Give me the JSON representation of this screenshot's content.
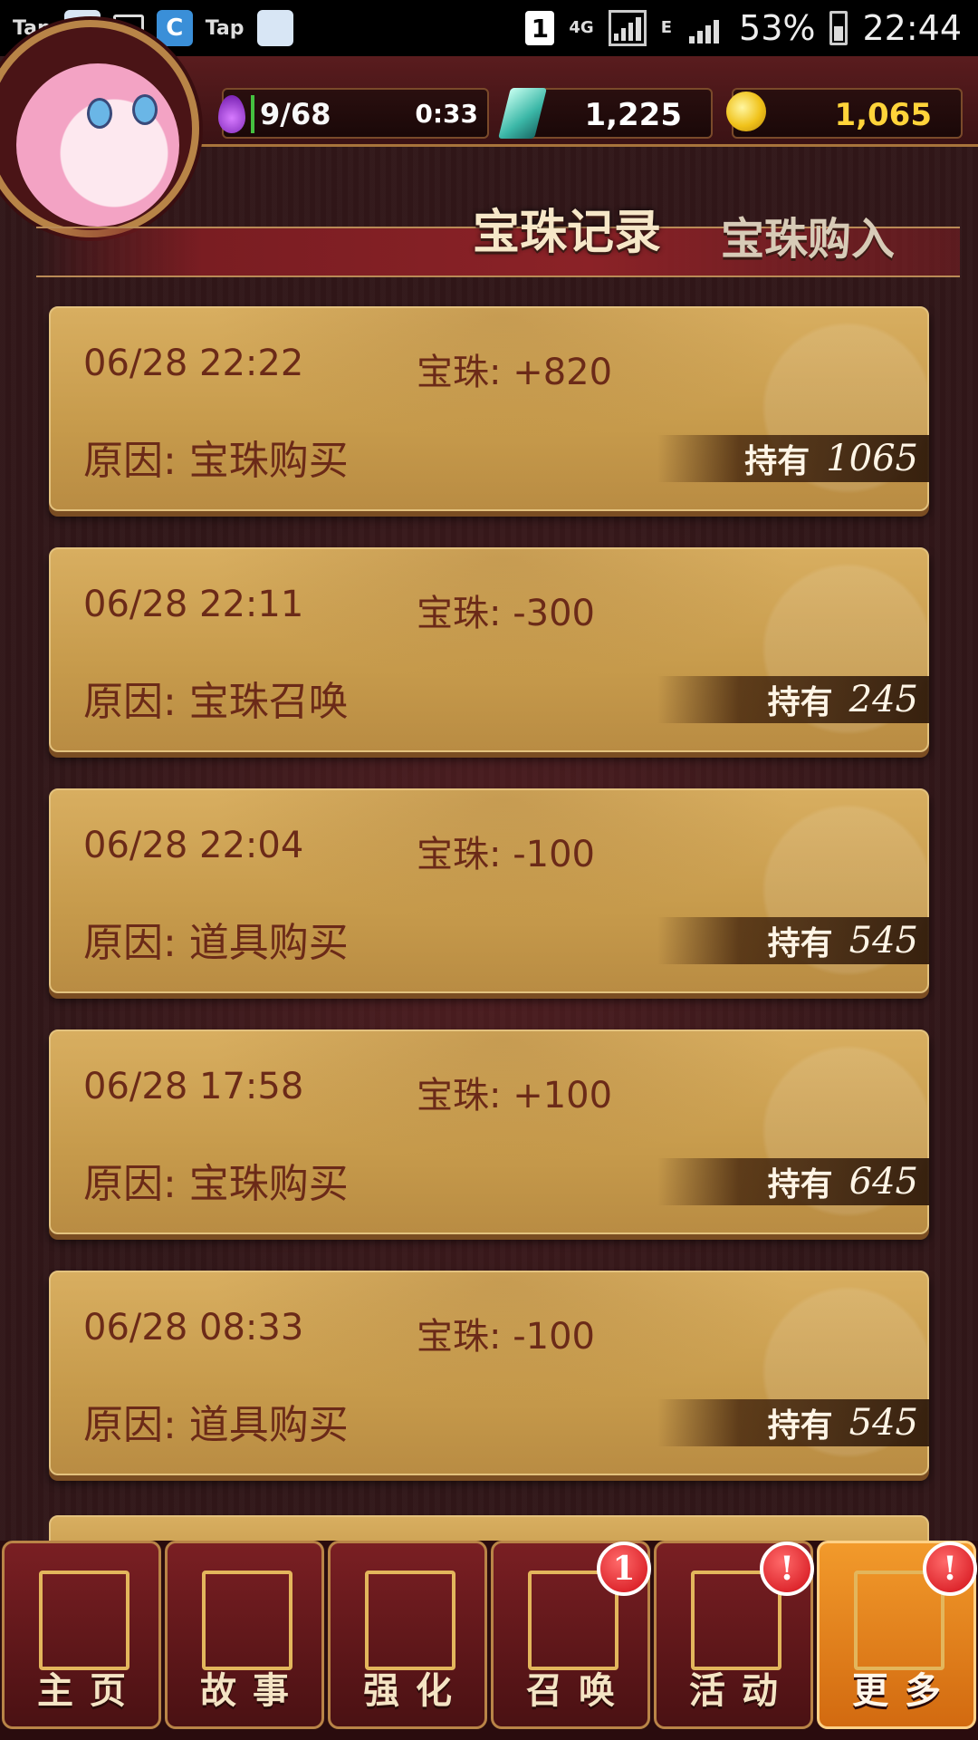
{
  "status_bar": {
    "left_apps": [
      "Tap",
      "Tap"
    ],
    "sim": "1",
    "network": "4G",
    "network_small": "E",
    "battery": "53%",
    "time": "22:44"
  },
  "hud": {
    "stamina": "9/68",
    "timer": "0:33",
    "gems": "1,225",
    "coins": "1,065"
  },
  "header": {
    "title": "宝珠记录",
    "tab_buy": "宝珠购入"
  },
  "records": [
    {
      "time": "06/28 22:22",
      "delta": "宝珠: +820",
      "reason": "原因: 宝珠购买",
      "hold_label": "持有",
      "hold": "1065"
    },
    {
      "time": "06/28 22:11",
      "delta": "宝珠: -300",
      "reason": "原因: 宝珠召唤",
      "hold_label": "持有",
      "hold": "245"
    },
    {
      "time": "06/28 22:04",
      "delta": "宝珠: -100",
      "reason": "原因: 道具购买",
      "hold_label": "持有",
      "hold": "545"
    },
    {
      "time": "06/28 17:58",
      "delta": "宝珠: +100",
      "reason": "原因: 宝珠购买",
      "hold_label": "持有",
      "hold": "645"
    },
    {
      "time": "06/28 08:33",
      "delta": "宝珠: -100",
      "reason": "原因: 道具购买",
      "hold_label": "持有",
      "hold": "545"
    }
  ],
  "nav": [
    {
      "label": "主页",
      "icon": "home-scroll-icon"
    },
    {
      "label": "故事",
      "icon": "story-book-icon"
    },
    {
      "label": "强化",
      "icon": "upgrade-icon"
    },
    {
      "label": "召唤",
      "icon": "summon-icon",
      "badge": "1"
    },
    {
      "label": "活动",
      "icon": "event-icon",
      "badge": "!"
    },
    {
      "label": "更多",
      "icon": "more-icon",
      "badge": "!",
      "active": true
    }
  ],
  "colors": {
    "card": "#c69a4b",
    "card_text": "#6b2a18",
    "accent_orange": "#f29a2b",
    "badge_red": "#d10d16"
  }
}
